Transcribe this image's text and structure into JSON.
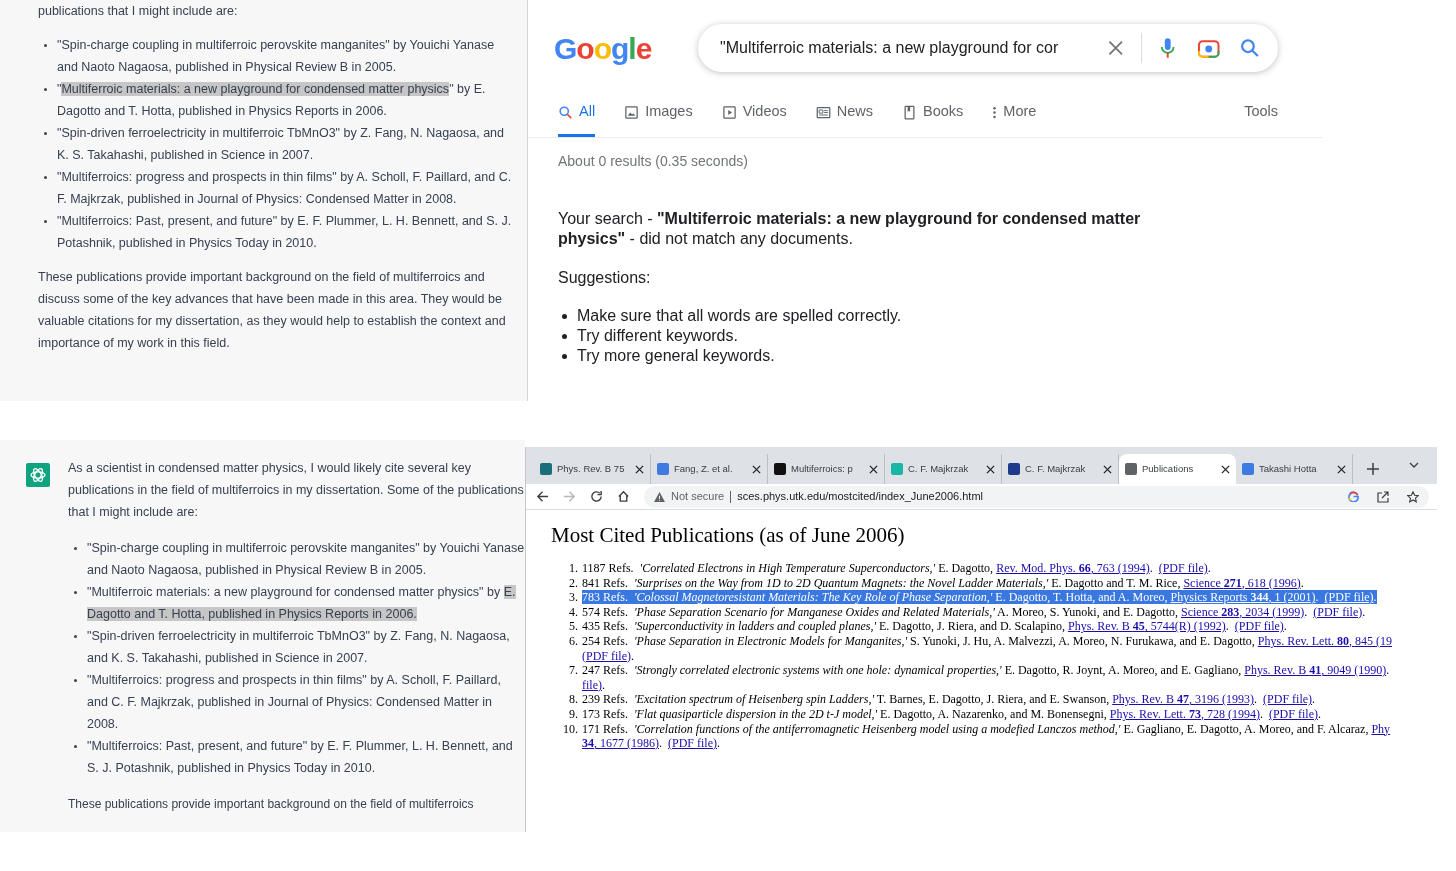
{
  "chat_top": {
    "intro": "publications that I might include are:",
    "items": [
      {
        "parts": [
          {
            "text": "\"Spin-charge coupling in multiferroic perovskite manganites\" by Youichi Yanase and Naoto Nagaosa, published in Physical Review B in 2005.",
            "highlighted": false
          }
        ]
      },
      {
        "parts": [
          {
            "text": "\"",
            "highlighted": false
          },
          {
            "text": "Multiferroic materials: a new playground for condensed matter physics",
            "highlighted": true
          },
          {
            "text": "\" by E. Dagotto and T. Hotta, published in Physics Reports in 2006.",
            "highlighted": false
          }
        ]
      },
      {
        "parts": [
          {
            "text": "\"Spin-driven ferroelectricity in multiferroic TbMnO3\" by Z. Fang, N. Nagaosa, and K. S. Takahashi, published in Science in 2007.",
            "highlighted": false
          }
        ]
      },
      {
        "parts": [
          {
            "text": "\"Multiferroics: progress and prospects in thin films\" by A. Scholl, F. Paillard, and C. F. Majkrzak, published in Journal of Physics: Condensed Matter in 2008.",
            "highlighted": false
          }
        ]
      },
      {
        "parts": [
          {
            "text": "\"Multiferroics: Past, present, and future\" by E. F. Plummer, L. H. Bennett, and S. J. Potashnik, published in Physics Today in 2010.",
            "highlighted": false
          }
        ]
      }
    ],
    "closing": "These publications provide important background on the field of multiferroics and discuss some of the key advances that have been made in this area. They would be valuable citations for my dissertation, as they would help to establish the context and importance of my work in this field."
  },
  "google": {
    "logo": "Google",
    "query": "\"Multiferroic materials: a new playground for cor",
    "tabs": [
      {
        "label": "All",
        "selected": true
      },
      {
        "label": "Images",
        "selected": false
      },
      {
        "label": "Videos",
        "selected": false
      },
      {
        "label": "News",
        "selected": false
      },
      {
        "label": "Books",
        "selected": false
      },
      {
        "label": "More",
        "selected": false
      }
    ],
    "tools": "Tools",
    "stats": "About 0 results (0.35 seconds)",
    "message": "Your search - **\"Multiferroic materials: a new playground for condensed matter physics\"** - did not match any documents.",
    "suggestions_heading": "Suggestions:",
    "suggestions": [
      "Make sure that all words are spelled correctly.",
      "Try different keywords.",
      "Try more general keywords."
    ]
  },
  "chat_bottom": {
    "intro": "As a scientist in condensed matter physics, I would likely cite several key publications in the field of multiferroics in my dissertation. Some of the publications that I might include are:",
    "items": [
      {
        "parts": [
          {
            "text": "\"Spin-charge coupling in multiferroic perovskite manganites\" by Youichi Yanase and Naoto Nagaosa, published in Physical Review B in 2005.",
            "highlighted": false
          }
        ]
      },
      {
        "parts": [
          {
            "text": "\"Multiferroic materials: a new playground for condensed matter physics\" by ",
            "highlighted": false
          },
          {
            "text": "E. Dagotto and T. Hotta, published in Physics Reports in 2006.",
            "highlighted": true
          }
        ]
      },
      {
        "parts": [
          {
            "text": "\"Spin-driven ferroelectricity in multiferroic TbMnO3\" by Z. Fang, N. Nagaosa, and K. S. Takahashi, published in Science in 2007.",
            "highlighted": false
          }
        ]
      },
      {
        "parts": [
          {
            "text": "\"Multiferroics: progress and prospects in thin films\" by A. Scholl, F. Paillard, and C. F. Majkrzak, published in Journal of Physics: Condensed Matter in 2008.",
            "highlighted": false
          }
        ]
      },
      {
        "parts": [
          {
            "text": "\"Multiferroics: Past, present, and future\" by E. F. Plummer, L. H. Bennett, and S. J. Potashnik, published in Physics Today in 2010.",
            "highlighted": false
          }
        ]
      }
    ],
    "closing": "These publications provide important background on the field of multiferroics"
  },
  "browser": {
    "tabs": [
      {
        "title": "Phys. Rev. B 75",
        "selected": false,
        "color": "#1b6f7d"
      },
      {
        "title": "Fang, Z. et al.",
        "selected": false,
        "color": "#3d7be0"
      },
      {
        "title": "Multiferroics: p",
        "selected": false,
        "color": "#111111"
      },
      {
        "title": "C. F. Majkrzak",
        "selected": false,
        "color": "#19b5a5"
      },
      {
        "title": "C. F. Majkrzak",
        "selected": false,
        "color": "#1e3a8a"
      },
      {
        "title": "Publications",
        "selected": true,
        "color": "#5f6368"
      },
      {
        "title": "Takashi Hotta",
        "selected": false,
        "color": "#3d7be0"
      }
    ],
    "forward_disabled": true,
    "security": "Not secure",
    "url": "sces.phys.utk.edu/mostcited/index_June2006.html",
    "heading": "Most Cited Publications (as of June 2006)",
    "citations": [
      {
        "number": "1.",
        "selected": false,
        "lines": [
          [
            {
              "kind": "text",
              "text": "1187 Refs.  "
            },
            {
              "kind": "title",
              "text": "'Correlated Electrons in High Temperature Superconductors,'"
            },
            {
              "kind": "text",
              "text": " E. Dagotto, "
            },
            {
              "kind": "link",
              "text": "Rev. Mod. Phys. **66**, 763 (1994)"
            },
            {
              "kind": "text",
              "text": ".  "
            },
            {
              "kind": "link",
              "text": "(PDF file)"
            },
            {
              "kind": "text",
              "text": "."
            }
          ]
        ]
      },
      {
        "number": "2.",
        "selected": false,
        "lines": [
          [
            {
              "kind": "text",
              "text": "841 Refs.  "
            },
            {
              "kind": "title",
              "text": "'Surprises on the Way from 1D to 2D Quantum Magnets: the Novel Ladder Materials,'"
            },
            {
              "kind": "text",
              "text": " E. Dagotto and T. M. Rice, "
            },
            {
              "kind": "link",
              "text": "Science  **271**, 618  (1996)"
            },
            {
              "kind": "text",
              "text": "."
            }
          ]
        ]
      },
      {
        "number": "3.",
        "selected": true,
        "lines": [
          [
            {
              "kind": "text",
              "text": "783 Refs.  "
            },
            {
              "kind": "title",
              "text": "'Colossal Magnetoresistant Materials: The Key Role of Phase Separation,'"
            },
            {
              "kind": "text",
              "text": " E. Dagotto, T. Hotta, and A. Moreo, "
            },
            {
              "kind": "link",
              "text": "Physics Reports **344**, 1 (2001)"
            },
            {
              "kind": "text",
              "text": ".  "
            },
            {
              "kind": "link",
              "text": "(PDF file)"
            },
            {
              "kind": "text",
              "text": "."
            }
          ]
        ]
      },
      {
        "number": "4.",
        "selected": false,
        "lines": [
          [
            {
              "kind": "text",
              "text": "574 Refs.  "
            },
            {
              "kind": "title",
              "text": "'Phase Separation Scenario for Manganese Oxides and Related Materials,'"
            },
            {
              "kind": "text",
              "text": " A. Moreo, S. Yunoki, and E. Dagotto, "
            },
            {
              "kind": "link",
              "text": "Science **283**, 2034 (1999)"
            },
            {
              "kind": "text",
              "text": ".  "
            },
            {
              "kind": "link",
              "text": "(PDF file)"
            },
            {
              "kind": "text",
              "text": "."
            }
          ]
        ]
      },
      {
        "number": "5.",
        "selected": false,
        "lines": [
          [
            {
              "kind": "text",
              "text": "435 Refs.  "
            },
            {
              "kind": "title",
              "text": "'Superconductivity in ladders and coupled planes,'"
            },
            {
              "kind": "text",
              "text": " E. Dagotto, J. Riera, and D. Scalapino, "
            },
            {
              "kind": "link",
              "text": "Phys. Rev. B **45**, 5744(R) (1992)"
            },
            {
              "kind": "text",
              "text": ".  "
            },
            {
              "kind": "link",
              "text": "(PDF file)"
            },
            {
              "kind": "text",
              "text": "."
            }
          ]
        ]
      },
      {
        "number": "6.",
        "selected": false,
        "lines": [
          [
            {
              "kind": "text",
              "text": "254 Refs.  "
            },
            {
              "kind": "title",
              "text": "'Phase Separation in Electronic Models for Manganites,'"
            },
            {
              "kind": "text",
              "text": " S. Yunoki, J. Hu, A. Malvezzi, A. Moreo, N. Furukawa, and E. Dagotto, "
            },
            {
              "kind": "link",
              "text": "Phys. Rev. Lett. **80**, 845 (19"
            }
          ],
          [
            {
              "kind": "link",
              "text": "(PDF file)"
            },
            {
              "kind": "text",
              "text": "."
            }
          ]
        ]
      },
      {
        "number": "7.",
        "selected": false,
        "lines": [
          [
            {
              "kind": "text",
              "text": "247 Refs.  "
            },
            {
              "kind": "title",
              "text": "'Strongly correlated electronic systems with one hole: dynamical properties,'"
            },
            {
              "kind": "text",
              "text": " E. Dagotto, R. Joynt, A. Moreo, and E. Gagliano, "
            },
            {
              "kind": "link",
              "text": "Phys. Rev. B  **41**, 9049 (1990)"
            },
            {
              "kind": "text",
              "text": "."
            }
          ],
          [
            {
              "kind": "link",
              "text": "file)"
            },
            {
              "kind": "text",
              "text": "."
            }
          ]
        ]
      },
      {
        "number": "8.",
        "selected": false,
        "lines": [
          [
            {
              "kind": "text",
              "text": "239 Refs.  "
            },
            {
              "kind": "title",
              "text": "'Excitation spectrum of Heisenberg spin Ladders,'"
            },
            {
              "kind": "text",
              "text": " T. Barnes, E. Dagotto, J. Riera, and E. Swanson, "
            },
            {
              "kind": "link",
              "text": "Phys. Rev. B **47**, 3196 (1993)"
            },
            {
              "kind": "text",
              "text": ".  "
            },
            {
              "kind": "link",
              "text": "(PDF file)"
            },
            {
              "kind": "text",
              "text": "."
            }
          ]
        ]
      },
      {
        "number": "9.",
        "selected": false,
        "lines": [
          [
            {
              "kind": "text",
              "text": "173 Refs.  "
            },
            {
              "kind": "title",
              "text": "'Flat quasiparticle dispersion in the 2D t-J model,'"
            },
            {
              "kind": "text",
              "text": " E. Dagotto, A. Nazarenko, and M. Bonensegni, "
            },
            {
              "kind": "link",
              "text": "Phys. Rev. Lett. **73**, 728 (1994)"
            },
            {
              "kind": "text",
              "text": ".  "
            },
            {
              "kind": "link",
              "text": "(PDF file)"
            },
            {
              "kind": "text",
              "text": "."
            }
          ]
        ]
      },
      {
        "number": "10.",
        "selected": false,
        "lines": [
          [
            {
              "kind": "text",
              "text": "171 Refs.  "
            },
            {
              "kind": "title",
              "text": "'Correlation functions of the antiferromagnetic Heisenberg model using a modefied Lanczos method,'"
            },
            {
              "kind": "text",
              "text": " E. Gagliano, E. Dagotto, A. Moreo, and F. Alcaraz, "
            },
            {
              "kind": "link",
              "text": "Phy"
            }
          ],
          [
            {
              "kind": "link",
              "text": "**34**, 1677 (1986)"
            },
            {
              "kind": "text",
              "text": ".  "
            },
            {
              "kind": "link",
              "text": "(PDF file)"
            },
            {
              "kind": "text",
              "text": "."
            }
          ]
        ]
      }
    ]
  }
}
